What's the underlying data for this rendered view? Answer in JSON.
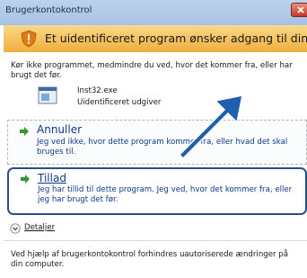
{
  "window": {
    "title": "Brugerkontokontrol"
  },
  "header": {
    "warning_text": "Et uidentificeret program ønsker adgang til din computer."
  },
  "content": {
    "intro_text": "Kør ikke programmet, medmindre du ved, hvor det kommer fra, eller har brugt det før.",
    "program_name": "Inst32.exe",
    "publisher": "Uidentificeret udgiver"
  },
  "options": {
    "cancel": {
      "label": "Annuller",
      "description": "Jeg ved ikke, hvor dette program kommer fra, eller hvad det skal bruges til."
    },
    "allow": {
      "label": "Tillad",
      "description": "Jeg har tillid til dette program. Jeg ved, hvor det kommer fra, eller jeg har brugt det før."
    }
  },
  "details": {
    "label": "Detaljer"
  },
  "footer": {
    "text": "Ved hjælp af brugerkontokontrol forhindres uautoriserede ændringer på din computer."
  },
  "icons": {
    "warning": "shield-warning-icon",
    "program": "application-icon",
    "option_arrow": "green-arrow-icon",
    "details": "chevron-down-circle-icon",
    "pointer": "blue-pointer-arrow"
  },
  "colors": {
    "header_bg": "#f0ae3c",
    "link_blue": "#0a3a8a",
    "selected_border": "#2c4e86",
    "pointer_arrow": "#1f5fae"
  }
}
